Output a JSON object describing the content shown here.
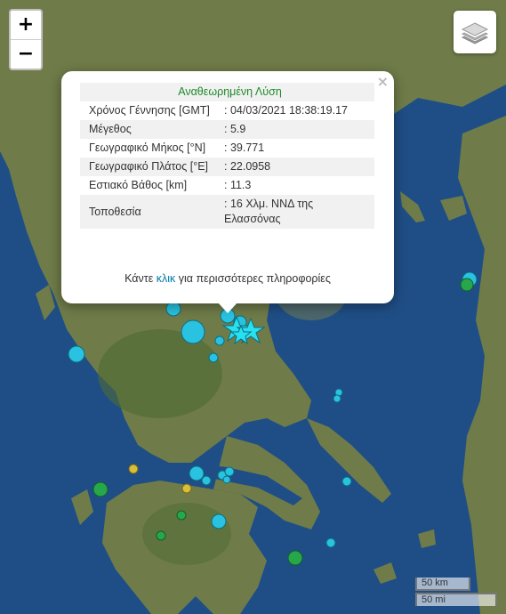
{
  "zoom": {
    "in_label": "+",
    "out_label": "−"
  },
  "layers": {
    "icon": "layers-icon"
  },
  "popup": {
    "close_label": "×",
    "heading": "Αναθεωρημένη Λύση",
    "rows": [
      {
        "key": "Χρόνος Γέννησης [GMT]",
        "value": ": 04/03/2021 18:38:19.17"
      },
      {
        "key": "Μέγεθος",
        "value": ": 5.9"
      },
      {
        "key": "Γεωγραφικό Μήκος [°N]",
        "value": ": 39.771"
      },
      {
        "key": "Γεωγραφικό Πλάτος [°E]",
        "value": ": 22.0958"
      },
      {
        "key": "Εστιακό Βάθος [km]",
        "value": ": 11.3"
      },
      {
        "key": "Τοποθεσία",
        "value": ": 16 Χλμ. ΝΝΔ της Ελασσόνας"
      }
    ],
    "more_prefix": "Κάντε ",
    "more_link": "κλικ",
    "more_suffix": " για περισσότερες πληροφορίες"
  },
  "scale": {
    "km_label": "50 km",
    "mi_label": "50 mi"
  },
  "colors": {
    "sea": "#1f4e86",
    "land": "#6f7c49",
    "quake_cyan": "#29c2e0",
    "quake_green": "#26a84a",
    "quake_yellow": "#d8bf3a"
  }
}
